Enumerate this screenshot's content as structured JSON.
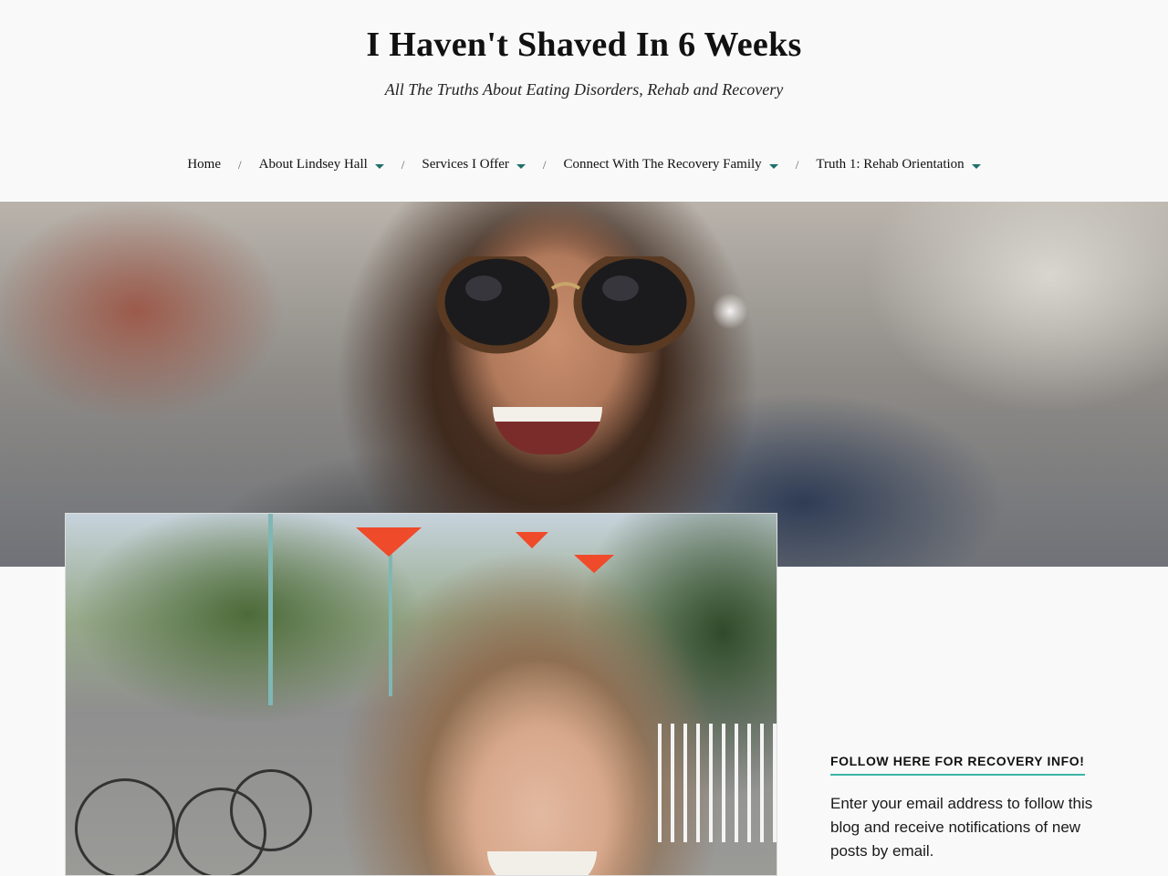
{
  "site": {
    "title": "I Haven't Shaved In 6 Weeks",
    "description": "All The Truths About Eating Disorders, Rehab and Recovery"
  },
  "nav": {
    "items": [
      {
        "label": "Home",
        "has_submenu": false
      },
      {
        "label": "About Lindsey Hall",
        "has_submenu": true
      },
      {
        "label": "Services I Offer",
        "has_submenu": true
      },
      {
        "label": "Connect With The Recovery Family",
        "has_submenu": true
      },
      {
        "label": "Truth 1: Rehab Orientation",
        "has_submenu": true
      }
    ],
    "separator": "/",
    "caret_color": "#1f6f6a"
  },
  "sidebar": {
    "widget_title": "Follow Here For Recovery Info!",
    "widget_text": "Enter your email address to follow this blog and receive notifications of new posts by email.",
    "accent_color": "#3ab5a6"
  }
}
